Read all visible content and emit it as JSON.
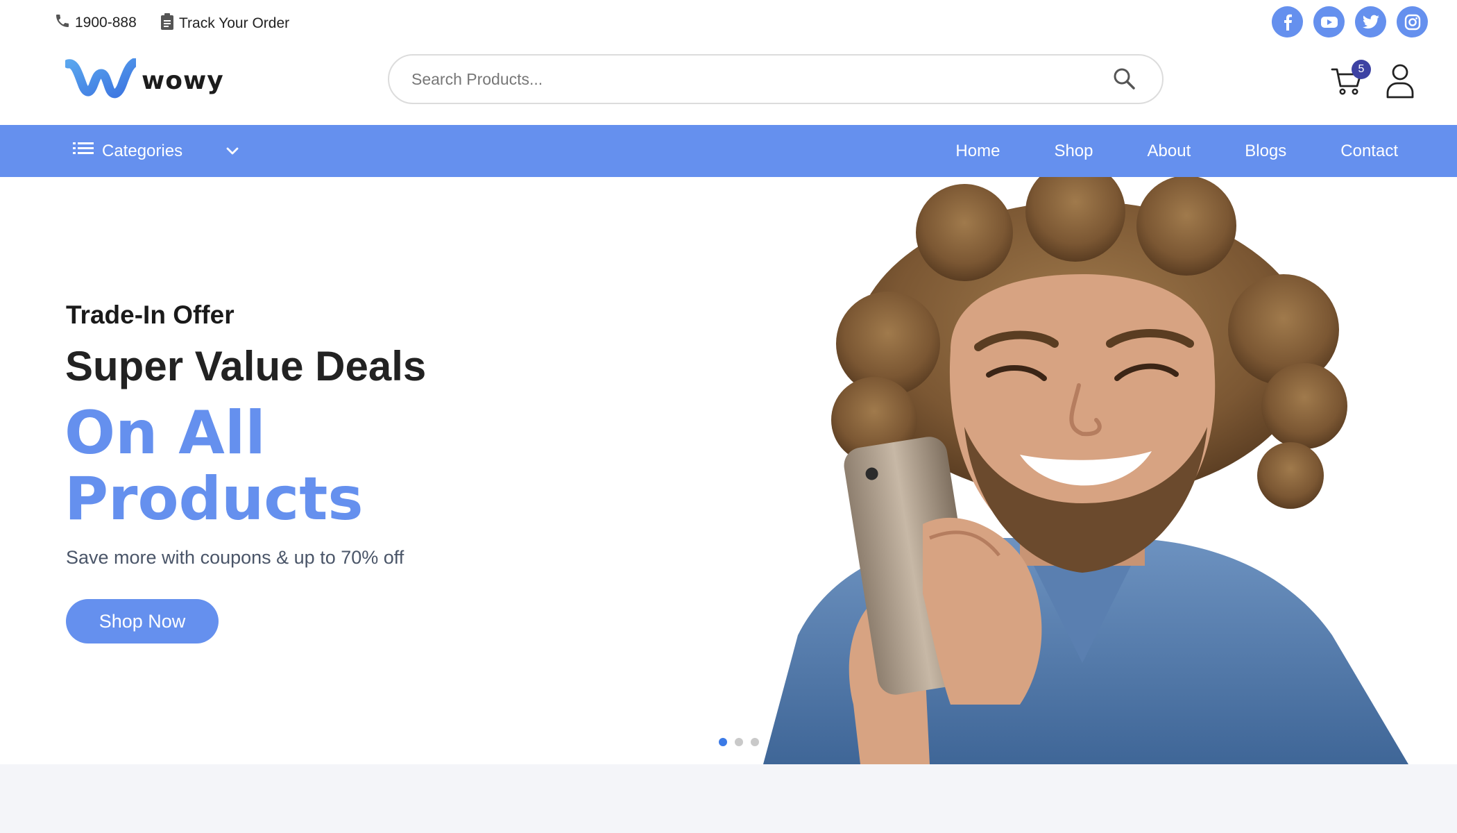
{
  "topbar": {
    "phone": "1900-888",
    "track_order": "Track Your Order",
    "social": [
      "facebook-icon",
      "youtube-icon",
      "twitter-icon",
      "instagram-icon"
    ]
  },
  "header": {
    "logo_text": "wowy",
    "search_placeholder": "Search Products...",
    "cart_count": "5"
  },
  "nav": {
    "categories_label": "Categories",
    "links": [
      "Home",
      "Shop",
      "About",
      "Blogs",
      "Contact"
    ]
  },
  "hero": {
    "subtitle": "Trade-In Offer",
    "title": "Super Value Deals",
    "accent_line1": "On All",
    "accent_line2": "Products",
    "description": "Save more with coupons & up to 70% off",
    "button_label": "Shop Now",
    "slides_total": 3,
    "active_slide": 1
  },
  "colors": {
    "accent": "#6590ee",
    "badge": "#3d42a3",
    "background_bottom": "#f4f5f9"
  }
}
